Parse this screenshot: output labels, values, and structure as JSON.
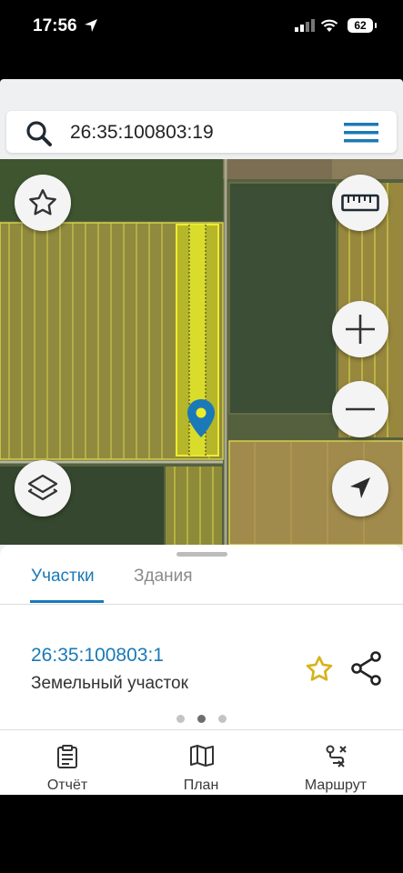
{
  "status": {
    "time": "17:56",
    "battery": "62"
  },
  "search": {
    "query": "26:35:100803:19"
  },
  "map": {
    "buttons": [
      "favorite-star",
      "ruler",
      "zoom-in",
      "zoom-out",
      "layers",
      "locate"
    ]
  },
  "sheet": {
    "tabs": [
      {
        "label": "Участки",
        "active": true
      },
      {
        "label": "Здания",
        "active": false
      }
    ],
    "result": {
      "cadastral_number": "26:35:100803:1",
      "type": "Земельный участок"
    },
    "pager": {
      "count": 3,
      "active_index": 1
    }
  },
  "bottom_nav": [
    {
      "label": "Отчёт",
      "icon": "report-icon"
    },
    {
      "label": "План",
      "icon": "map-plan-icon"
    },
    {
      "label": "Маршрут",
      "icon": "route-icon"
    }
  ],
  "colors": {
    "accent": "#1a79b6",
    "highlight_parcel": "#e5e52a",
    "star": "#d6b31c"
  }
}
